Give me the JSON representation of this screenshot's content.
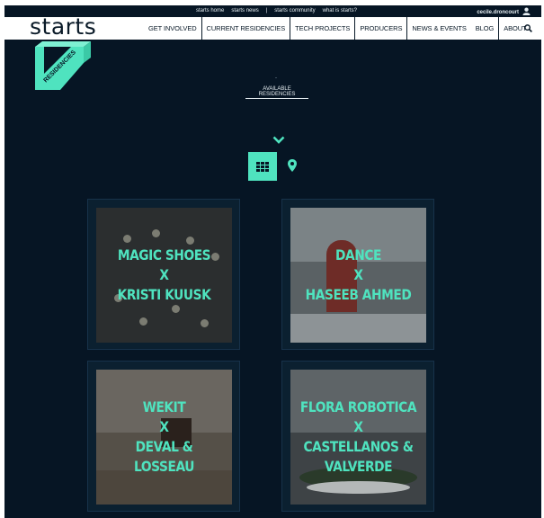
{
  "topbar": {
    "links": [
      "starts home",
      "starts news",
      "|",
      "starts community",
      "what is starts?"
    ],
    "user": "cecile.droncourt"
  },
  "nav": {
    "logo": "starts",
    "items": [
      "GET INVOLVED",
      "CURRENT RESIDENCIES",
      "TECH PROJECTS",
      "PRODUCERS",
      "NEWS & EVENTS",
      "BLOG",
      "ABOUT"
    ],
    "active_index": 1
  },
  "badge": {
    "text": "RESIDENCIES",
    "color": "#4fe3bf"
  },
  "header": {
    "dash": "-",
    "available_label": "AVAILABLE RESIDENCIES"
  },
  "view_toggle": {
    "grid_icon": "grid-icon",
    "map_icon": "map-pin-icon"
  },
  "accent_color": "#4fe3bf",
  "cards": [
    {
      "title": "MAGIC SHOES\nX\nKRISTI KUUSK"
    },
    {
      "title": "DANCE\nX\nHASEEB AHMED"
    },
    {
      "title": "WEKIT\nX\nDEVAL & LOSSEAU"
    },
    {
      "title": "FLORA ROBOTICA\nX\nCASTELLANOS &\nVALVERDE"
    }
  ]
}
